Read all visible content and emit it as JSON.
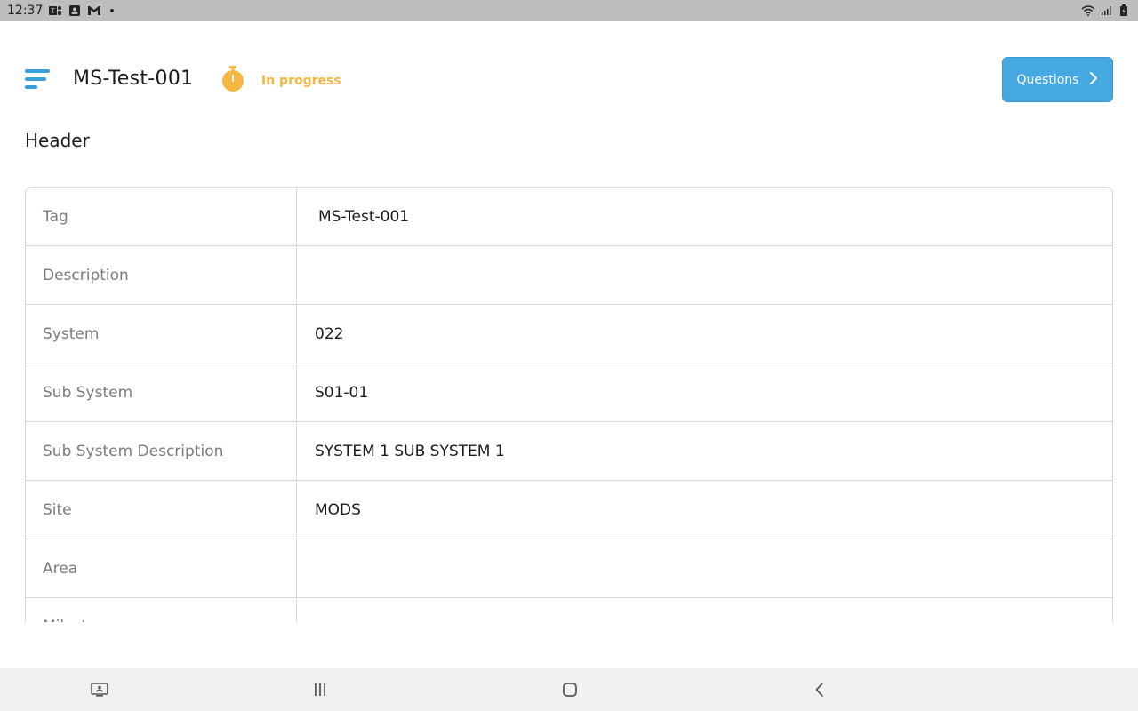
{
  "status_bar": {
    "time": "12:37",
    "icons": [
      "teams-icon",
      "contacts-icon",
      "gmail-icon",
      "notification-dot"
    ],
    "right_icons": [
      "wifi-icon",
      "signal-icon",
      "battery-icon"
    ]
  },
  "header": {
    "title": "MS-Test-001",
    "status": "In progress",
    "status_color": "#f5b642",
    "questions_label": "Questions",
    "accent_color": "#45a8e0"
  },
  "section": {
    "title": "Header"
  },
  "table": {
    "rows": [
      {
        "label": "Tag",
        "value": "MS-Test-001"
      },
      {
        "label": "Description",
        "value": ""
      },
      {
        "label": "System",
        "value": "022"
      },
      {
        "label": "Sub System",
        "value": "S01-01"
      },
      {
        "label": "Sub System Description",
        "value": "SYSTEM 1 SUB SYSTEM 1"
      },
      {
        "label": "Site",
        "value": "MODS"
      },
      {
        "label": "Area",
        "value": ""
      },
      {
        "label": "Milestone",
        "value": ""
      }
    ]
  },
  "nav": {
    "buttons": [
      "screenshot-icon",
      "recents-icon",
      "home-icon",
      "back-icon"
    ]
  }
}
